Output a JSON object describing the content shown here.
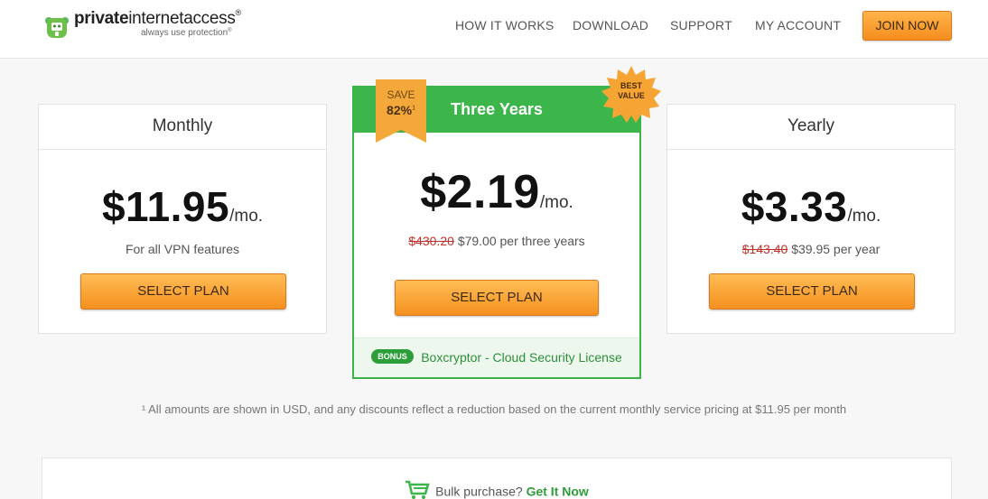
{
  "header": {
    "brand_bold": "private",
    "brand_rest": "internetaccess",
    "brand_mark": "®",
    "tagline": "always use protection",
    "tagline_mark": "®",
    "nav": [
      "HOW IT WORKS",
      "DOWNLOAD",
      "SUPPORT",
      "MY ACCOUNT"
    ],
    "join_label": "JOIN NOW"
  },
  "plans": {
    "monthly": {
      "title": "Monthly",
      "price": "$11.95",
      "period": "/mo.",
      "note": "For all VPN features",
      "button": "SELECT PLAN"
    },
    "three_years": {
      "title": "Three Years",
      "price": "$2.19",
      "period": "/mo.",
      "old_price": "$430.20",
      "new_price": "$79.00 per three years",
      "button": "SELECT PLAN",
      "save_label": "SAVE",
      "save_pct": "82%",
      "save_mark": "1",
      "badge": "BEST VALUE",
      "bonus_tag": "BONUS",
      "bonus_text": "Boxcryptor - Cloud Security License"
    },
    "yearly": {
      "title": "Yearly",
      "price": "$3.33",
      "period": "/mo.",
      "old_price": "$143.40",
      "new_price": "$39.95 per year",
      "button": "SELECT PLAN"
    }
  },
  "footnote": "¹ All amounts are shown in USD, and any discounts reflect a reduction based on the current monthly service pricing at $11.95 per month",
  "bulk": {
    "question": "Bulk purchase?",
    "link": "Get It Now"
  },
  "colors": {
    "green": "#3cb54a",
    "orange": "#f5901f",
    "strike_red": "#c0322b"
  },
  "icons": [
    "pia-shield-logo-icon",
    "cart-icon"
  ]
}
